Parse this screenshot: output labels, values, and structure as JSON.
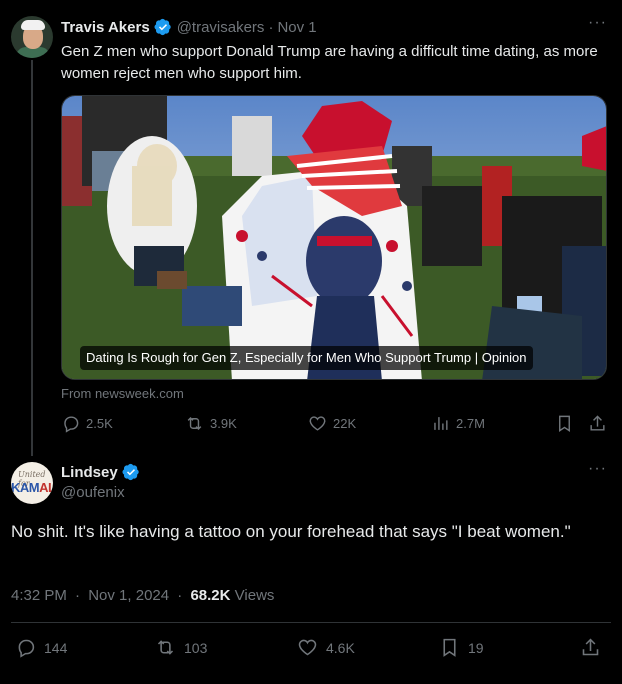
{
  "tweet1": {
    "author": {
      "name": "Travis Akers",
      "handle": "@travisakers",
      "date": "Nov 1",
      "verified": true
    },
    "text": "Gen Z men who support Donald Trump are having a difficult time dating, as more women reject men who support him.",
    "media": {
      "headline": "Dating Is Rough for Gen Z, Especially for Men Who Support Trump | Opinion"
    },
    "source": "From newsweek.com",
    "actions": {
      "replies": "2.5K",
      "reposts": "3.9K",
      "likes": "22K",
      "views": "2.7M"
    }
  },
  "tweet2": {
    "author": {
      "name": "Lindsey",
      "handle": "@oufenix",
      "verified": true,
      "avatar_text_top": "United for",
      "avatar_text_main_a": "KAM",
      "avatar_text_main_b": "ALA"
    },
    "text": "No shit. It's like having a tattoo on your forehead that says \"I beat women.\"",
    "time": "4:32 PM",
    "date": "Nov 1, 2024",
    "views_count": "68.2K",
    "views_label": "Views",
    "actions": {
      "replies": "144",
      "reposts": "103",
      "likes": "4.6K",
      "bookmarks": "19"
    }
  },
  "colors": {
    "background": "#000000",
    "text": "#e7e9ea",
    "muted": "#71767b",
    "verified": "#1d9bf0",
    "divider": "#2f3336"
  }
}
